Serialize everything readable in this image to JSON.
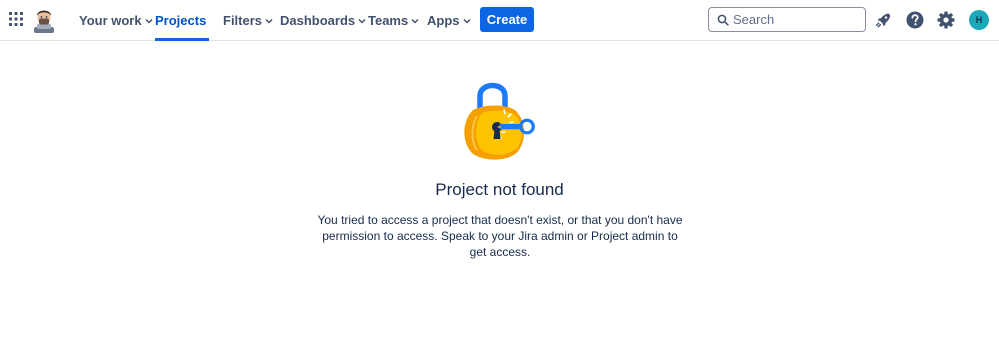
{
  "topbar": {
    "nav": [
      {
        "label": "Your work",
        "active": false
      },
      {
        "label": "Projects",
        "active": true
      },
      {
        "label": "Filters",
        "active": false
      },
      {
        "label": "Dashboards",
        "active": false
      },
      {
        "label": "Teams",
        "active": false
      },
      {
        "label": "Apps",
        "active": false
      }
    ],
    "create_label": "Create",
    "search_placeholder": "Search",
    "avatar_initial": "H",
    "icons": [
      "app-switcher-icon",
      "notifications-icon",
      "help-icon",
      "settings-icon"
    ]
  },
  "empty_state": {
    "title": "Project not found",
    "description": "You tried to access a project that doesn't exist, or that you don't have permission to access. Speak to your Jira admin or Project admin to get access."
  },
  "colors": {
    "accent": "#0c66e4",
    "active_nav": "#0052cc",
    "text_primary": "#172b4d",
    "text_nav": "#42526e",
    "lock_body": "#ffab00",
    "lock_shackle": "#1d7afc",
    "avatar_bg": "#1ba8b8"
  }
}
